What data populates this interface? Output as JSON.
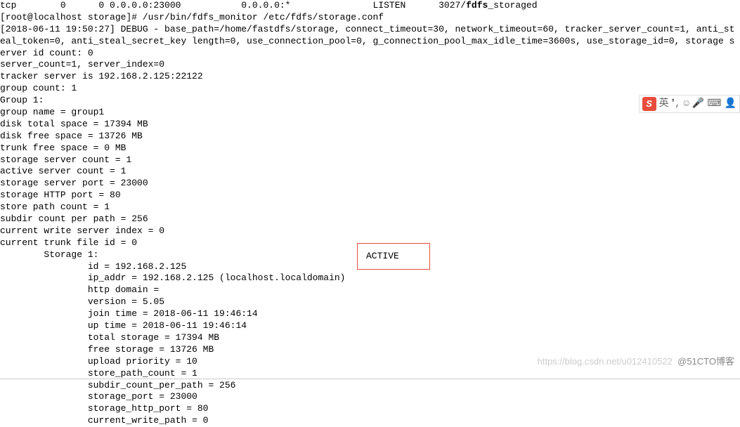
{
  "terminal": {
    "line0": "tcp        0      0 0.0.0.0:23000           0.0.0.0:*               LISTEN      3027/",
    "line0_bold": "fdfs",
    "line0_suffix": "_storaged",
    "line1": "[root@localhost storage]# /usr/bin/fdfs_monitor /etc/fdfs/storage.conf",
    "line2": "[2018-06-11 19:50:27] DEBUG - base_path=/home/fastdfs/storage, connect_timeout=30, network_timeout=60, tracker_server_count=1, anti_st",
    "line3": "eal_token=0, anti_steal_secret_key length=0, use_connection_pool=0, g_connection_pool_max_idle_time=3600s, use_storage_id=0, storage s",
    "line4": "erver id count: 0",
    "line5": "",
    "line6": "server_count=1, server_index=0",
    "line7": "",
    "line8": "tracker server is 192.168.2.125:22122",
    "line9": "",
    "line10": "group count: 1",
    "line11": "",
    "line12": "Group 1:",
    "line13": "group name = group1",
    "line14": "disk total space = 17394 MB",
    "line15": "disk free space = 13726 MB",
    "line16": "trunk free space = 0 MB",
    "line17": "storage server count = 1",
    "line18": "active server count = 1",
    "line19": "storage server port = 23000",
    "line20": "storage HTTP port = 80",
    "line21": "store path count = 1",
    "line22": "subdir count per path = 256",
    "line23": "current write server index = 0",
    "line24": "current trunk file id = 0",
    "line25": "",
    "line26": "        Storage 1:",
    "line27": "                id = 192.168.2.125",
    "line28": "                ip_addr = 192.168.2.125 (localhost.localdomain)",
    "line29": "                http domain = ",
    "line30": "                version = 5.05",
    "line31": "                join time = 2018-06-11 19:46:14",
    "line32": "                up time = 2018-06-11 19:46:14",
    "line33": "                total storage = 17394 MB",
    "line34": "                free storage = 13726 MB",
    "line35": "                upload priority = 10",
    "line36": "                store_path_count = 1",
    "line37": "                subdir_count_per_path = 256",
    "line38": "                storage_port = 23000",
    "line39": "                storage_http_port = 80",
    "line40": "                current_write_path = 0"
  },
  "active_status": "ACTIVE",
  "watermark": {
    "text": "@51CTO博客",
    "url": "https://blog.csdn.net/u012410522"
  },
  "ime": {
    "s": "S",
    "lang": "英",
    "punct": "❜,",
    "emoji": "☺",
    "mic": "🎤",
    "keyboard": "⌨",
    "user": "👤"
  }
}
